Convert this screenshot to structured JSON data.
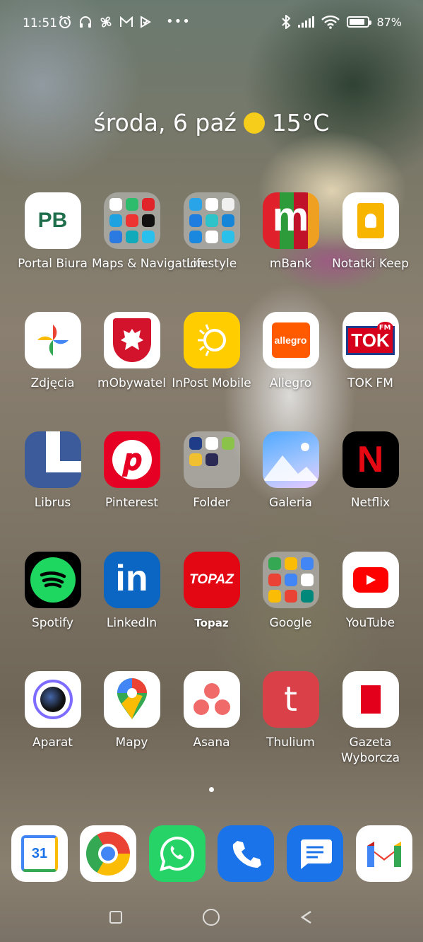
{
  "status_bar": {
    "time": "11:51",
    "battery_text": "87%",
    "battery_level": 0.87,
    "left_icons": [
      "alarm-icon",
      "headphones-icon",
      "fan-icon",
      "gmail-notification-icon",
      "tick-notification-icon",
      "more-icon"
    ],
    "right_icons": [
      "bluetooth-icon",
      "signal-icon",
      "wifi-icon",
      "battery-icon"
    ]
  },
  "widget": {
    "date": "środa, 6 paź",
    "temperature": "15°C",
    "weather_icon": "sun-icon"
  },
  "apps": [
    [
      {
        "label": "Portal Biura"
      },
      {
        "label": "Maps & Navigation"
      },
      {
        "label": "Lifestyle"
      },
      {
        "label": "mBank"
      },
      {
        "label": "Notatki Keep"
      }
    ],
    [
      {
        "label": "Zdjęcia"
      },
      {
        "label": "mObywatel"
      },
      {
        "label": "InPost Mobile"
      },
      {
        "label": "Allegro"
      },
      {
        "label": "TOK FM"
      }
    ],
    [
      {
        "label": "Librus"
      },
      {
        "label": "Pinterest"
      },
      {
        "label": "Folder"
      },
      {
        "label": "Galeria"
      },
      {
        "label": "Netflix"
      }
    ],
    [
      {
        "label": "Spotify"
      },
      {
        "label": "LinkedIn"
      },
      {
        "label": "Topaz"
      },
      {
        "label": "Google"
      },
      {
        "label": "YouTube"
      }
    ],
    [
      {
        "label": "Aparat"
      },
      {
        "label": "Mapy"
      },
      {
        "label": "Asana"
      },
      {
        "label": "Thulium"
      },
      {
        "label": "Gazeta Wyborcza"
      }
    ]
  ],
  "icon_text": {
    "portal": "PB",
    "mbank": "m",
    "allegro": "allegro",
    "tokfm": "TOK",
    "tokfm_sub": "FM",
    "linkedin": "in",
    "topaz": "TOPAZ",
    "thulium": "t",
    "calendar": "31",
    "netflix": "N"
  },
  "dock": [
    "calendar-app",
    "chrome-app",
    "whatsapp-app",
    "phone-app",
    "messages-app",
    "gmail-app"
  ],
  "page_indicator": {
    "pages": 2,
    "current": 1
  },
  "nav_bar": [
    "recents-button",
    "home-button",
    "back-button"
  ]
}
